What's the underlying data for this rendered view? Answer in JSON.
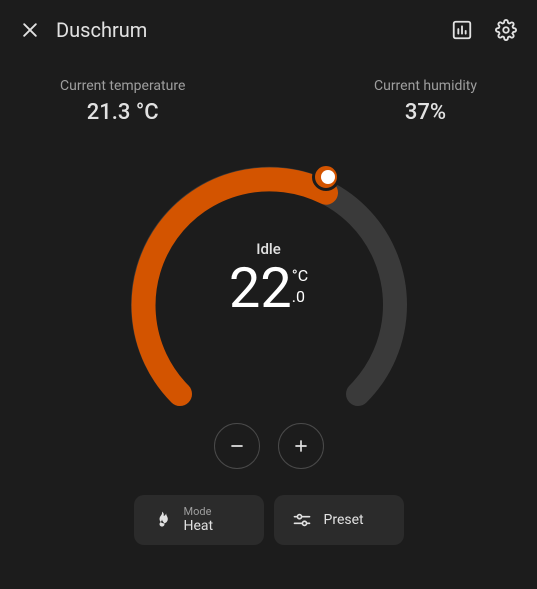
{
  "header": {
    "title": "Duschrum"
  },
  "stats": {
    "temp_label": "Current temperature",
    "temp_value": "21.3 °C",
    "humidity_label": "Current humidity",
    "humidity_value": "37%"
  },
  "dial": {
    "status": "Idle",
    "target_main": "22",
    "target_unit": "°C",
    "target_decimal": ".0",
    "accent": "#d35400",
    "track": "#3a3a3a"
  },
  "controls": {
    "mode_label": "Mode",
    "mode_value": "Heat",
    "preset_label": "Preset"
  }
}
